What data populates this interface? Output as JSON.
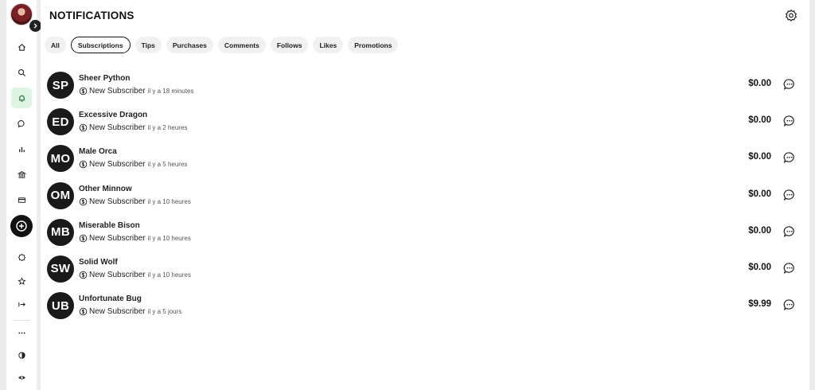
{
  "page_title": "NOTIFICATIONS",
  "tabs": [
    {
      "label": "All",
      "active": false
    },
    {
      "label": "Subscriptions",
      "active": true
    },
    {
      "label": "Tips",
      "active": false
    },
    {
      "label": "Purchases",
      "active": false
    },
    {
      "label": "Comments",
      "active": false
    },
    {
      "label": "Follows",
      "active": false
    },
    {
      "label": "Likes",
      "active": false
    },
    {
      "label": "Promotions",
      "active": false
    }
  ],
  "notifications": [
    {
      "initials": "SP",
      "name": "Sheer Python",
      "event": "New Subscriber",
      "time": "il y a 18 minutes",
      "amount": "$0.00"
    },
    {
      "initials": "ED",
      "name": "Excessive Dragon",
      "event": "New Subscriber",
      "time": "il y a 2 heures",
      "amount": "$0.00"
    },
    {
      "initials": "MO",
      "name": "Male Orca",
      "event": "New Subscriber",
      "time": "il y a 5 heures",
      "amount": "$0.00"
    },
    {
      "initials": "OM",
      "name": "Other Minnow",
      "event": "New Subscriber",
      "time": "il y a 10 heures",
      "amount": "$0.00"
    },
    {
      "initials": "MB",
      "name": "Miserable Bison",
      "event": "New Subscriber",
      "time": "il y a 10 heures",
      "amount": "$0.00"
    },
    {
      "initials": "SW",
      "name": "Solid Wolf",
      "event": "New Subscriber",
      "time": "il y a 10 heures",
      "amount": "$0.00"
    },
    {
      "initials": "UB",
      "name": "Unfortunate Bug",
      "event": "New Subscriber",
      "time": "il y a 5 jours",
      "amount": "$9.99"
    }
  ],
  "sidebar": {
    "icons": [
      "home-icon",
      "search-icon",
      "bell-icon",
      "chat-icon",
      "bar-chart-icon",
      "bank-icon",
      "card-icon",
      "plus-circle-icon",
      "badge-icon",
      "star-icon",
      "logout-icon",
      "more-icon",
      "contrast-icon",
      "eye-icon"
    ],
    "active": "bell-icon"
  },
  "colors": {
    "accent_active_bg": "#dff5e3",
    "avatar_bg": "#1a1a1a",
    "page_bg": "#ececec"
  }
}
